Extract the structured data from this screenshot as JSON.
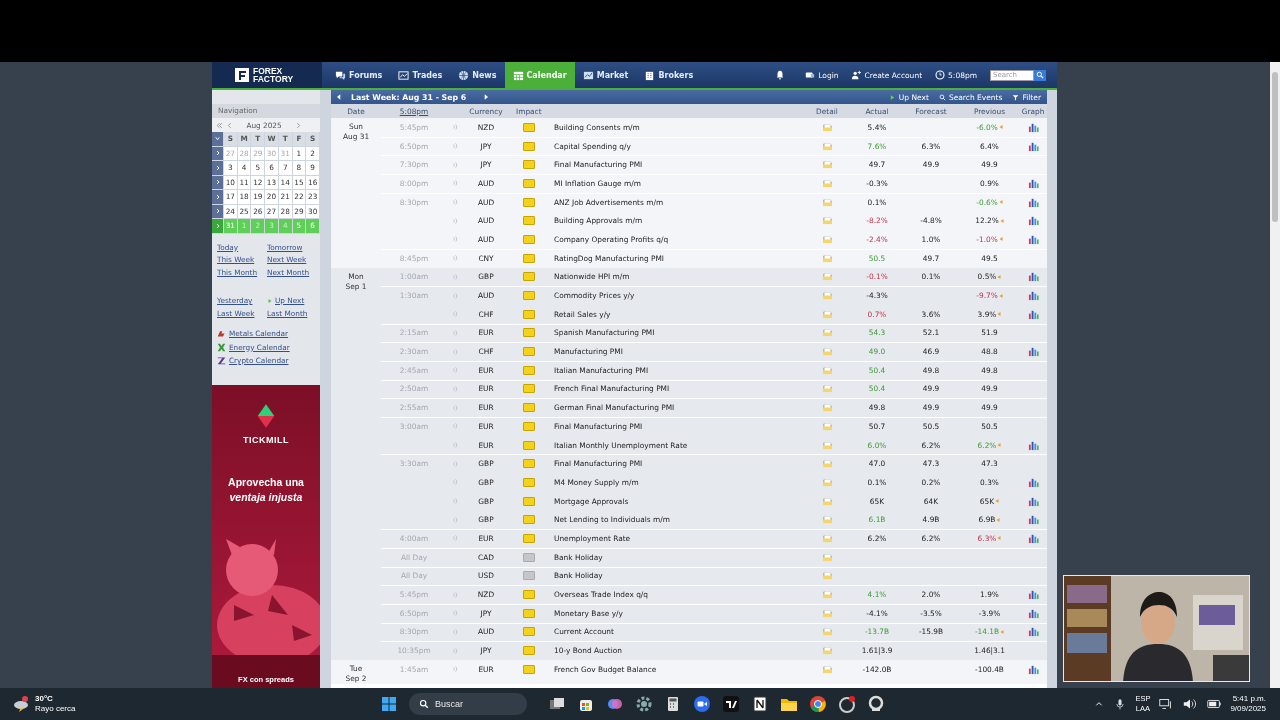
{
  "header": {
    "logo": "FOREX FACTORY",
    "nav": [
      {
        "label": "Forums",
        "kind": "forums",
        "selected": false
      },
      {
        "label": "Trades",
        "kind": "trades",
        "selected": false
      },
      {
        "label": "News",
        "kind": "news",
        "selected": false
      },
      {
        "label": "Calendar",
        "kind": "calendar",
        "selected": true
      },
      {
        "label": "Market",
        "kind": "market",
        "selected": false
      },
      {
        "label": "Brokers",
        "kind": "brokers",
        "selected": false
      }
    ],
    "login": "Login",
    "create_account": "Create Account",
    "time": "5:08pm",
    "search": {
      "placeholder": "Search"
    }
  },
  "sidebar": {
    "title": "Navigation",
    "month": "Aug 2025",
    "weekdays": [
      "S",
      "M",
      "T",
      "W",
      "T",
      "F",
      "S"
    ],
    "weeks": [
      {
        "selected": false,
        "days": [
          {
            "day": "27",
            "muted": true
          },
          {
            "day": "28",
            "muted": true
          },
          {
            "day": "29",
            "muted": true
          },
          {
            "day": "30",
            "muted": true
          },
          {
            "day": "31",
            "muted": true
          },
          {
            "day": "1",
            "muted": false
          },
          {
            "day": "2",
            "muted": false
          }
        ]
      },
      {
        "selected": false,
        "days": [
          {
            "day": "3",
            "muted": false
          },
          {
            "day": "4",
            "muted": false
          },
          {
            "day": "5",
            "muted": false
          },
          {
            "day": "6",
            "muted": false
          },
          {
            "day": "7",
            "muted": false
          },
          {
            "day": "8",
            "muted": false
          },
          {
            "day": "9",
            "muted": false
          }
        ]
      },
      {
        "selected": false,
        "days": [
          {
            "day": "10",
            "muted": false
          },
          {
            "day": "11",
            "muted": false
          },
          {
            "day": "12",
            "muted": false
          },
          {
            "day": "13",
            "muted": false
          },
          {
            "day": "14",
            "muted": false
          },
          {
            "day": "15",
            "muted": false
          },
          {
            "day": "16",
            "muted": false
          }
        ]
      },
      {
        "selected": false,
        "days": [
          {
            "day": "17",
            "muted": false
          },
          {
            "day": "18",
            "muted": false
          },
          {
            "day": "19",
            "muted": false
          },
          {
            "day": "20",
            "muted": false
          },
          {
            "day": "21",
            "muted": false
          },
          {
            "day": "22",
            "muted": false
          },
          {
            "day": "23",
            "muted": false
          }
        ]
      },
      {
        "selected": false,
        "days": [
          {
            "day": "24",
            "muted": false
          },
          {
            "day": "25",
            "muted": false
          },
          {
            "day": "26",
            "muted": false
          },
          {
            "day": "27",
            "muted": false
          },
          {
            "day": "28",
            "muted": false
          },
          {
            "day": "29",
            "muted": false
          },
          {
            "day": "30",
            "muted": false
          }
        ]
      },
      {
        "selected": true,
        "days": [
          {
            "day": "31",
            "muted": false
          },
          {
            "day": "1",
            "muted": true
          },
          {
            "day": "2",
            "muted": true
          },
          {
            "day": "3",
            "muted": true
          },
          {
            "day": "4",
            "muted": true
          },
          {
            "day": "5",
            "muted": false
          },
          {
            "day": "6",
            "muted": false
          }
        ]
      }
    ],
    "link_groups": [
      {
        "links": [
          {
            "label": "Today",
            "kind": "link"
          },
          {
            "label": "Tomorrow",
            "kind": "link"
          },
          {
            "label": "This Week",
            "kind": "link"
          },
          {
            "label": "Next Week",
            "kind": "link"
          },
          {
            "label": "This Month",
            "kind": "link"
          },
          {
            "label": "Next Month",
            "kind": "link"
          }
        ]
      },
      {
        "links": [
          {
            "label": "Yesterday",
            "kind": "link"
          },
          {
            "label": "Up Next",
            "kind": "up-next"
          },
          {
            "label": "Last Week",
            "kind": "link"
          },
          {
            "label": "Last Month",
            "kind": "link"
          }
        ]
      }
    ],
    "calendars": [
      {
        "label": "Metals Calendar",
        "kind": "metals"
      },
      {
        "label": "Energy Calendar",
        "kind": "energy"
      },
      {
        "label": "Crypto Calendar",
        "kind": "crypto"
      }
    ]
  },
  "ad": {
    "brand": "TICKMILL",
    "headline": "Aprovecha una *ventaja injusta*",
    "footer": "FX con spreads"
  },
  "calendar": {
    "week_label": "Last Week: Aug 31 - Sep 6",
    "actions": [
      {
        "label": "Up Next",
        "kind": "up-next"
      },
      {
        "label": "Search Events",
        "kind": "search"
      },
      {
        "label": "Filter",
        "kind": "filter"
      }
    ],
    "columns": [
      "Date",
      "5:08pm",
      "Currency",
      "Impact",
      "Detail",
      "Actual",
      "Forecast",
      "Previous",
      "Graph"
    ],
    "days": [
      {
        "day": "Sun",
        "date": "Aug 31",
        "events": [
          {
            "time": "5:45pm",
            "alert": true,
            "currency": "NZD",
            "kind": "event",
            "title": "Building Consents m/m",
            "actual": "5.4%",
            "actual_good": false,
            "actual_bad": false,
            "previous": "-6.0%",
            "previous_good": true,
            "previous_bad": false,
            "revised": true,
            "graph": true
          },
          {
            "time": "6:50pm",
            "alert": true,
            "currency": "JPY",
            "kind": "event",
            "title": "Capital Spending q/y",
            "actual": "7.6%",
            "actual_good": true,
            "actual_bad": false,
            "forecast": "6.3%",
            "previous": "6.4%",
            "previous_good": false,
            "previous_bad": false,
            "revised": false,
            "graph": true
          },
          {
            "time": "7:30pm",
            "alert": true,
            "currency": "JPY",
            "kind": "event",
            "title": "Final Manufacturing PMI",
            "actual": "49.7",
            "actual_good": false,
            "actual_bad": false,
            "forecast": "49.9",
            "previous": "49.9",
            "previous_good": false,
            "previous_bad": false,
            "revised": false,
            "graph": false
          },
          {
            "time": "8:00pm",
            "alert": true,
            "currency": "AUD",
            "kind": "event",
            "title": "MI Inflation Gauge m/m",
            "actual": "-0.3%",
            "actual_good": false,
            "actual_bad": false,
            "previous": "0.9%",
            "previous_good": false,
            "previous_bad": false,
            "revised": false,
            "graph": true
          },
          {
            "time": "8:30pm",
            "alert": true,
            "currency": "AUD",
            "kind": "event",
            "title": "ANZ Job Advertisements m/m",
            "actual": "0.1%",
            "actual_good": false,
            "actual_bad": false,
            "previous": "-0.6%",
            "previous_good": true,
            "previous_bad": false,
            "revised": true,
            "graph": true
          },
          {
            "alert": true,
            "currency": "AUD",
            "kind": "event",
            "title": "Building Approvals m/m",
            "actual": "-8.2%",
            "actual_good": false,
            "actual_bad": true,
            "forecast": "-4.8%",
            "previous": "12.2%",
            "previous_good": false,
            "previous_bad": false,
            "revised": true,
            "graph": true
          },
          {
            "alert": true,
            "currency": "AUD",
            "kind": "event",
            "title": "Company Operating Profits q/q",
            "actual": "-2.4%",
            "actual_good": false,
            "actual_bad": true,
            "forecast": "1.0%",
            "previous": "-1.0%",
            "previous_good": false,
            "previous_bad": true,
            "revised": true,
            "graph": true
          },
          {
            "time": "8:45pm",
            "alert": true,
            "currency": "CNY",
            "kind": "event",
            "title": "RatingDog Manufacturing PMI",
            "actual": "50.5",
            "actual_good": true,
            "actual_bad": false,
            "forecast": "49.7",
            "previous": "49.5",
            "previous_good": false,
            "previous_bad": false,
            "revised": false,
            "graph": false
          }
        ]
      },
      {
        "day": "Mon",
        "date": "Sep 1",
        "events": [
          {
            "time": "1:00am",
            "alert": true,
            "currency": "GBP",
            "kind": "event",
            "title": "Nationwide HPI m/m",
            "actual": "-0.1%",
            "actual_good": false,
            "actual_bad": true,
            "forecast": "0.1%",
            "previous": "0.5%",
            "previous_good": false,
            "previous_bad": false,
            "revised": true,
            "graph": true
          },
          {
            "time": "1:30am",
            "alert": true,
            "currency": "AUD",
            "kind": "event",
            "title": "Commodity Prices y/y",
            "actual": "-4.3%",
            "actual_good": false,
            "actual_bad": false,
            "previous": "-9.7%",
            "previous_good": false,
            "previous_bad": true,
            "revised": true,
            "graph": true
          },
          {
            "alert": true,
            "currency": "CHF",
            "kind": "event",
            "title": "Retail Sales y/y",
            "actual": "0.7%",
            "actual_good": false,
            "actual_bad": true,
            "forecast": "3.6%",
            "previous": "3.9%",
            "previous_good": false,
            "previous_bad": false,
            "revised": true,
            "graph": true
          },
          {
            "time": "2:15am",
            "alert": true,
            "currency": "EUR",
            "kind": "event",
            "title": "Spanish Manufacturing PMI",
            "actual": "54.3",
            "actual_good": true,
            "actual_bad": false,
            "forecast": "52.1",
            "previous": "51.9",
            "previous_good": false,
            "previous_bad": false,
            "revised": false,
            "graph": false
          },
          {
            "time": "2:30am",
            "alert": true,
            "currency": "CHF",
            "kind": "event",
            "title": "Manufacturing PMI",
            "actual": "49.0",
            "actual_good": true,
            "actual_bad": false,
            "forecast": "46.9",
            "previous": "48.8",
            "previous_good": false,
            "previous_bad": false,
            "revised": false,
            "graph": true
          },
          {
            "time": "2:45am",
            "alert": true,
            "currency": "EUR",
            "kind": "event",
            "title": "Italian Manufacturing PMI",
            "actual": "50.4",
            "actual_good": true,
            "actual_bad": false,
            "forecast": "49.8",
            "previous": "49.8",
            "previous_good": false,
            "previous_bad": false,
            "revised": false,
            "graph": false
          },
          {
            "time": "2:50am",
            "alert": true,
            "currency": "EUR",
            "kind": "event",
            "title": "French Final Manufacturing PMI",
            "actual": "50.4",
            "actual_good": true,
            "actual_bad": false,
            "forecast": "49.9",
            "previous": "49.9",
            "previous_good": false,
            "previous_bad": false,
            "revised": false,
            "graph": false
          },
          {
            "time": "2:55am",
            "alert": true,
            "currency": "EUR",
            "kind": "event",
            "title": "German Final Manufacturing PMI",
            "actual": "49.8",
            "actual_good": false,
            "actual_bad": false,
            "forecast": "49.9",
            "previous": "49.9",
            "previous_good": false,
            "previous_bad": false,
            "revised": false,
            "graph": false
          },
          {
            "time": "3:00am",
            "alert": true,
            "currency": "EUR",
            "kind": "event",
            "title": "Final Manufacturing PMI",
            "actual": "50.7",
            "actual_good": false,
            "actual_bad": false,
            "forecast": "50.5",
            "previous": "50.5",
            "previous_good": false,
            "previous_bad": false,
            "revised": false,
            "graph": false
          },
          {
            "alert": true,
            "currency": "EUR",
            "kind": "event",
            "title": "Italian Monthly Unemployment Rate",
            "actual": "6.0%",
            "actual_good": true,
            "actual_bad": false,
            "forecast": "6.2%",
            "previous": "6.2%",
            "previous_good": true,
            "previous_bad": false,
            "revised": true,
            "graph": true
          },
          {
            "time": "3:30am",
            "alert": true,
            "currency": "GBP",
            "kind": "event",
            "title": "Final Manufacturing PMI",
            "actual": "47.0",
            "actual_good": false,
            "actual_bad": false,
            "forecast": "47.3",
            "previous": "47.3",
            "previous_good": false,
            "previous_bad": false,
            "revised": false,
            "graph": false
          },
          {
            "alert": true,
            "currency": "GBP",
            "kind": "event",
            "title": "M4 Money Supply m/m",
            "actual": "0.1%",
            "actual_good": false,
            "actual_bad": false,
            "forecast": "0.2%",
            "previous": "0.3%",
            "previous_good": false,
            "previous_bad": false,
            "revised": false,
            "graph": true
          },
          {
            "alert": true,
            "currency": "GBP",
            "kind": "event",
            "title": "Mortgage Approvals",
            "actual": "65K",
            "actual_good": false,
            "actual_bad": false,
            "forecast": "64K",
            "previous": "65K",
            "previous_good": false,
            "previous_bad": false,
            "revised": true,
            "graph": true
          },
          {
            "alert": true,
            "currency": "GBP",
            "kind": "event",
            "title": "Net Lending to Individuals m/m",
            "actual": "6.1B",
            "actual_good": true,
            "actual_bad": false,
            "forecast": "4.9B",
            "previous": "6.9B",
            "previous_good": false,
            "previous_bad": false,
            "revised": true,
            "graph": true
          },
          {
            "time": "4:00am",
            "alert": true,
            "currency": "EUR",
            "kind": "event",
            "title": "Unemployment Rate",
            "actual": "6.2%",
            "actual_good": false,
            "actual_bad": false,
            "forecast": "6.2%",
            "previous": "6.3%",
            "previous_good": false,
            "previous_bad": true,
            "revised": true,
            "graph": true
          },
          {
            "time": "All Day",
            "alert": false,
            "currency": "CAD",
            "kind": "holiday",
            "title": "Bank Holiday",
            "revised": false,
            "graph": false
          },
          {
            "time": "All Day",
            "alert": false,
            "currency": "USD",
            "kind": "holiday",
            "title": "Bank Holiday",
            "revised": false,
            "graph": false
          },
          {
            "time": "5:45pm",
            "alert": true,
            "currency": "NZD",
            "kind": "event",
            "title": "Overseas Trade Index q/q",
            "actual": "4.1%",
            "actual_good": true,
            "actual_bad": false,
            "forecast": "2.0%",
            "previous": "1.9%",
            "previous_good": false,
            "previous_bad": false,
            "revised": false,
            "graph": true
          },
          {
            "time": "6:50pm",
            "alert": true,
            "currency": "JPY",
            "kind": "event",
            "title": "Monetary Base y/y",
            "actual": "-4.1%",
            "actual_good": false,
            "actual_bad": false,
            "forecast": "-3.5%",
            "previous": "-3.9%",
            "previous_good": false,
            "previous_bad": false,
            "revised": false,
            "graph": true
          },
          {
            "time": "8:30pm",
            "alert": true,
            "currency": "AUD",
            "kind": "event",
            "title": "Current Account",
            "actual": "-13.7B",
            "actual_good": true,
            "actual_bad": false,
            "forecast": "-15.9B",
            "previous": "-14.1B",
            "previous_good": true,
            "previous_bad": false,
            "revised": true,
            "graph": true
          },
          {
            "time": "10:35pm",
            "alert": true,
            "currency": "JPY",
            "kind": "event",
            "title": "10-y Bond Auction",
            "actual": "1.61|3.9",
            "actual_good": false,
            "actual_bad": false,
            "previous": "1.46|3.1",
            "previous_good": false,
            "previous_bad": false,
            "revised": false,
            "graph": false
          }
        ]
      },
      {
        "day": "Tue",
        "date": "Sep 2",
        "events": [
          {
            "time": "1:45am",
            "alert": true,
            "currency": "EUR",
            "kind": "event",
            "title": "French Gov Budget Balance",
            "actual": "-142.0B",
            "actual_good": false,
            "actual_bad": false,
            "previous": "-100.4B",
            "previous_good": false,
            "previous_bad": false,
            "revised": false,
            "graph": true
          }
        ]
      }
    ]
  },
  "taskbar": {
    "weather": {
      "temp": "30°C",
      "desc": "Rayo cerca"
    },
    "search": {
      "placeholder": "Buscar"
    },
    "language": [
      "ESP",
      "LAA"
    ],
    "time": "5:41 p.m.",
    "date": "9/09/2025"
  }
}
